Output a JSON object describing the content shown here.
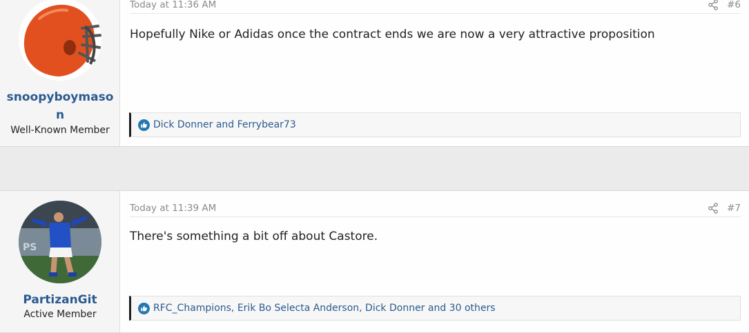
{
  "posts": [
    {
      "username": "snoopyboymason",
      "user_title": "Well-Known Member",
      "avatar_icon": "helmet-icon",
      "date": "Today at 11:36 AM",
      "post_number": "#6",
      "message": "Hopefully Nike or Adidas once the contract ends we are now a very attractive proposition",
      "reactions": "Dick Donner and Ferrybear73"
    },
    {
      "username": "PartizanGit",
      "user_title": "Active Member",
      "avatar_icon": "player-photo-icon",
      "date": "Today at 11:39 AM",
      "post_number": "#7",
      "message": "There's something a bit off about Castore.",
      "reactions": "RFC_Champions, Erik Bo Selecta Anderson, Dick Donner and 30 others"
    }
  ],
  "colors": {
    "link": "#2b5a8f",
    "like": "#2577b1",
    "helmet": "#e2501f"
  }
}
